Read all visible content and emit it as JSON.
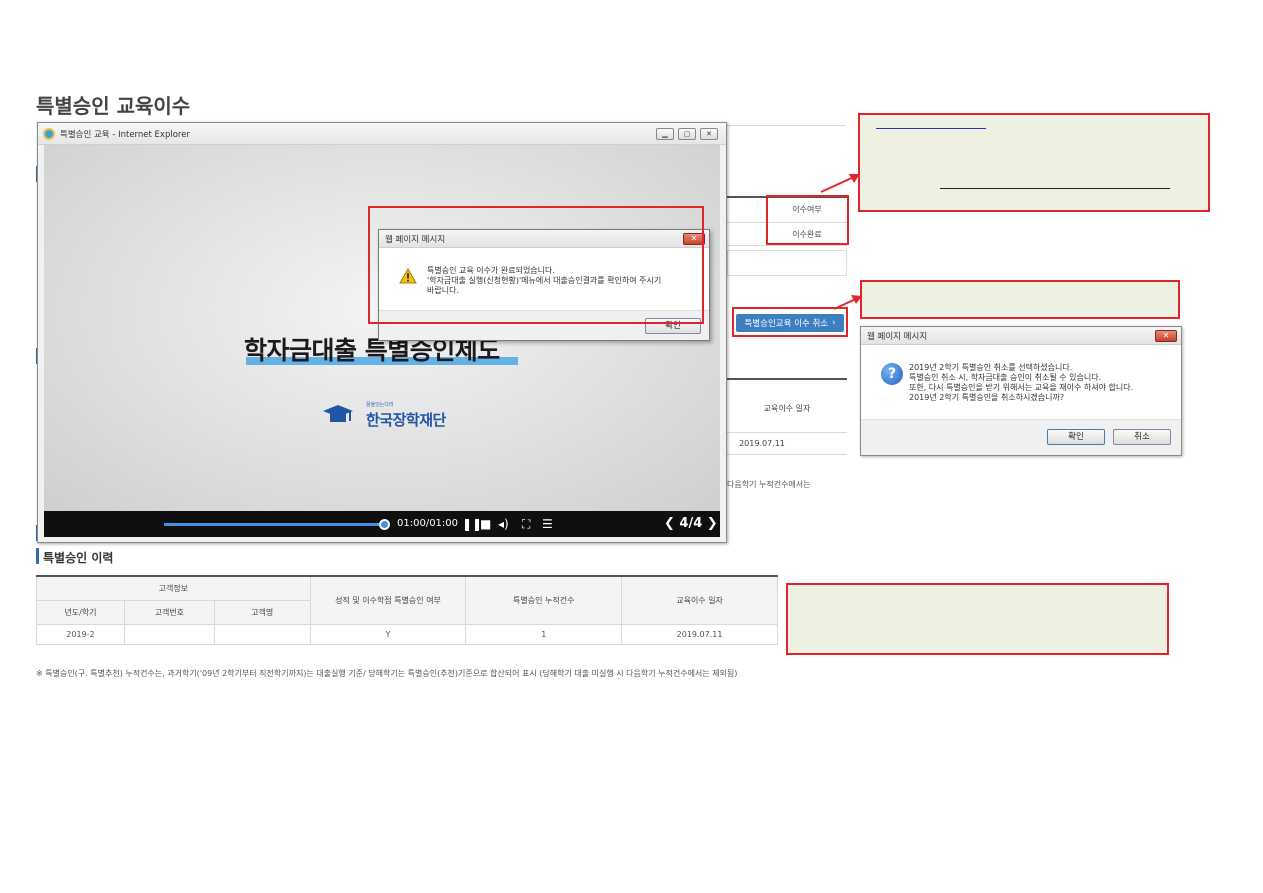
{
  "page": {
    "title": "특별승인 교육이수"
  },
  "background": {
    "completion_header": "이수여부",
    "completion_value": "이수완료",
    "cancel_button": "특별승인교육 이수 취소",
    "edu_date_header": "교육이수 일자",
    "edu_date_value": "2019.07.11",
    "note_fragment": "다음학기 누적건수에서는"
  },
  "popup_window": {
    "title": "특별승인 교육 - Internet Explorer",
    "video": {
      "headline": "학자금대출 특별승인제도",
      "brand_small": "꿈을잇는다리",
      "brand_name": "한국장학재단"
    },
    "player": {
      "progress": 1.0,
      "time": "01:00/01:00",
      "page_counter": "4/4"
    }
  },
  "dialog_complete": {
    "title": "웹 페이지 메시지",
    "lines": [
      "특별승인 교육 이수가 완료되었습니다.",
      "'학자금대출 실행(신청현황)'메뉴에서 대출승인결과를 확인하여 주시기",
      "바랍니다."
    ],
    "ok_label": "확인"
  },
  "dialog_cancel": {
    "title": "웹 페이지 메시지",
    "lines": [
      "2019년 2학기 특별승인 취소를 선택하셨습니다.",
      "특별승인 취소 시, 학자금대출 승인이 취소될 수 있습니다.",
      "또한, 다시 특별승인을 받기 위해서는 교육을 재이수 하셔야 합니다.",
      "2019년 2학기 특별승인을 취소하시겠습니까?"
    ],
    "ok_label": "확인",
    "cancel_label": "취소"
  },
  "history": {
    "section_title": "특별승인 이력",
    "group_header": "고객정보",
    "headers": {
      "term": "년도/학기",
      "customer_no": "고객번호",
      "customer_name": "고객명",
      "grade_special": "성적 및 이수학점 특별승인 여부",
      "count": "특별승인 누적건수",
      "edu_date": "교육이수 일자"
    },
    "rows": [
      {
        "term": "2019-2",
        "customer_no": "",
        "customer_name": "",
        "grade_special": "Y",
        "count": "1",
        "edu_date": "2019.07.11"
      }
    ],
    "footnote": "※ 특별승인(구. 특별추천) 누적건수는, 과거학기('09년 2학기부터 직전학기까지)는 대출실행 기준/ 당해학기는 특별승인(추천)기준으로 합산되어 표시 (당해학기 대출 미실행 시 다음학기 누적건수에서는 제외됨)"
  },
  "colors": {
    "highlight_red": "#e0262c",
    "note_bg": "#eef1e1",
    "accent_blue": "#2f6db3"
  }
}
